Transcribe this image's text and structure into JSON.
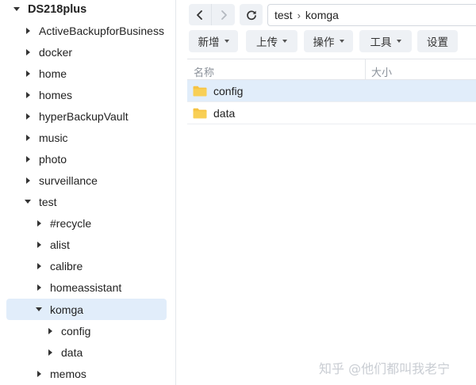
{
  "sidebar": {
    "root": "DS218plus",
    "items": [
      {
        "label": "ActiveBackupforBusiness"
      },
      {
        "label": "docker"
      },
      {
        "label": "home"
      },
      {
        "label": "homes"
      },
      {
        "label": "hyperBackupVault"
      },
      {
        "label": "music"
      },
      {
        "label": "photo"
      },
      {
        "label": "surveillance"
      },
      {
        "label": "test"
      },
      {
        "label": "#recycle"
      },
      {
        "label": "alist"
      },
      {
        "label": "calibre"
      },
      {
        "label": "homeassistant"
      },
      {
        "label": "komga"
      },
      {
        "label": "config"
      },
      {
        "label": "data"
      },
      {
        "label": "memos"
      }
    ]
  },
  "toolbar": {
    "path": [
      "test",
      "komga"
    ],
    "path_separator": "›",
    "buttons": {
      "create": "新增",
      "upload": "上传",
      "action": "操作",
      "tools": "工具",
      "settings": "设置"
    }
  },
  "file_list": {
    "columns": {
      "name": "名称",
      "size": "大小"
    },
    "rows": [
      {
        "name": "config"
      },
      {
        "name": "data"
      }
    ]
  },
  "watermark": "知乎 @他们都叫我老宁",
  "colors": {
    "selection": "#e1edfa",
    "folder": "#f6c343",
    "button_bg": "#eef1f5"
  }
}
